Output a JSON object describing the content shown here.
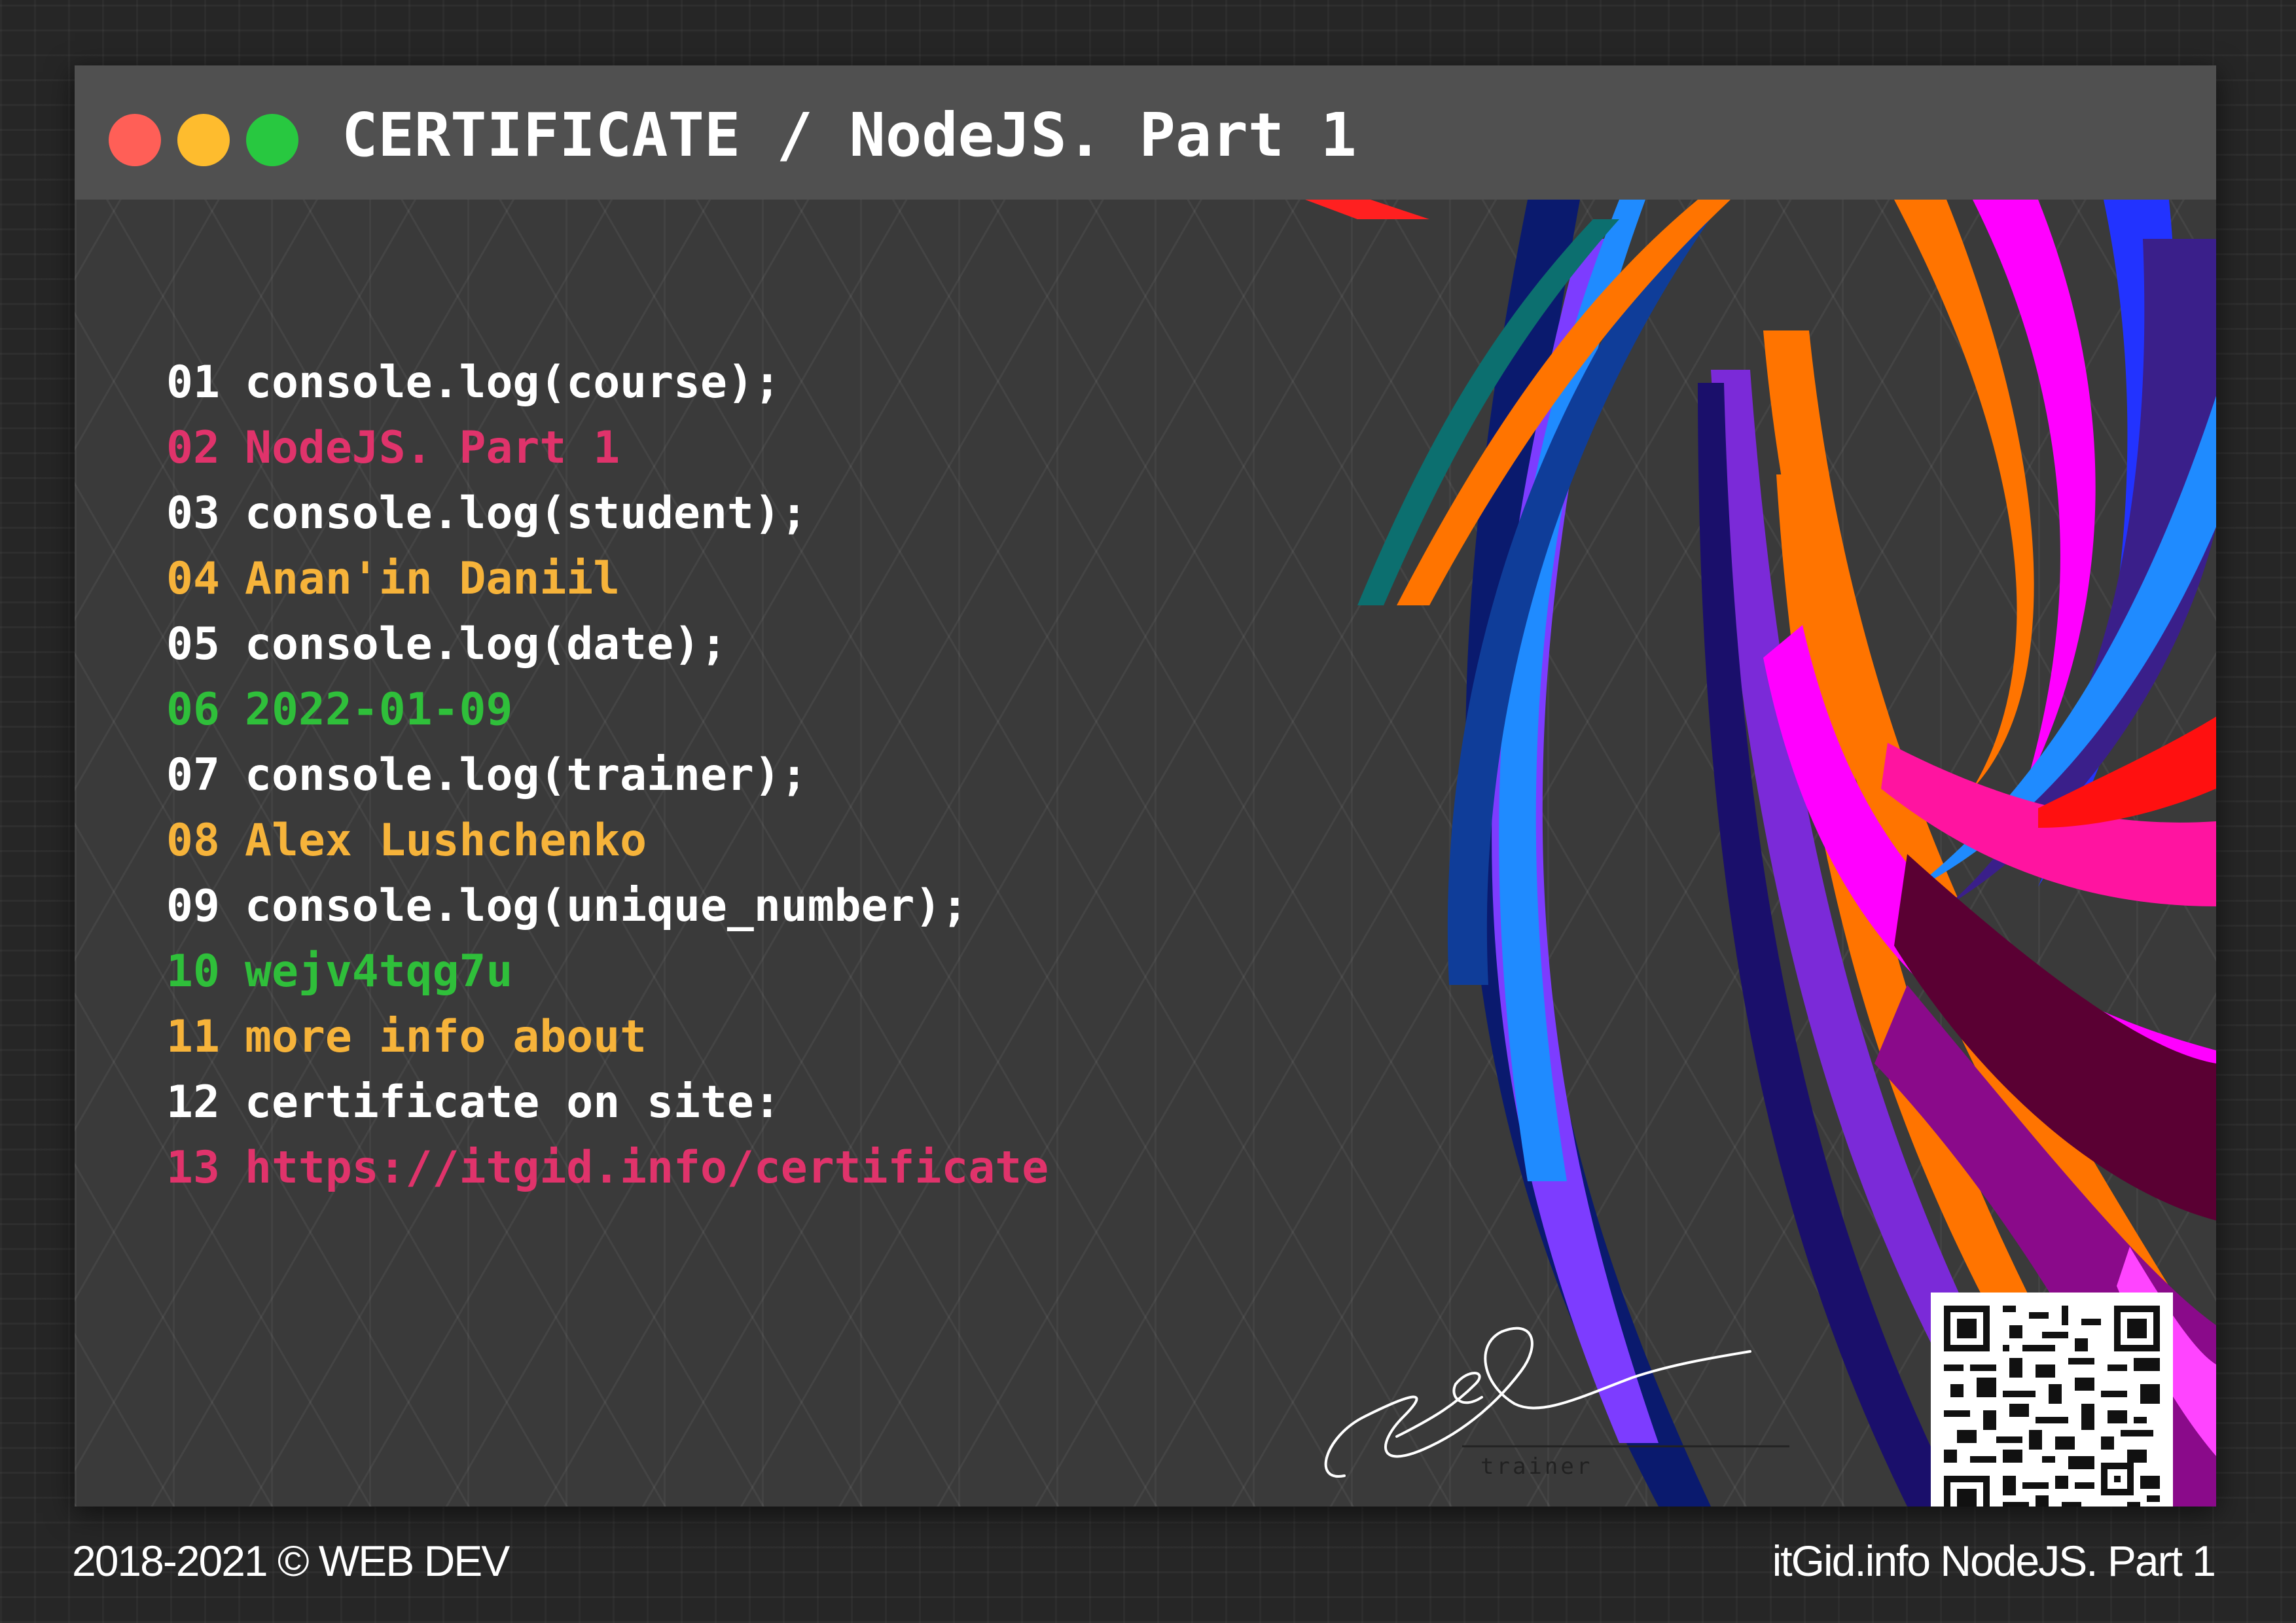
{
  "window": {
    "title": "CERTIFICATE / NodeJS. Part 1",
    "controls": [
      {
        "name": "close",
        "color": "#ff5f57"
      },
      {
        "name": "minimize",
        "color": "#febc2e"
      },
      {
        "name": "maximize",
        "color": "#28c840"
      }
    ]
  },
  "code_lines": [
    {
      "num": "01",
      "text": "console.log(course);",
      "color": "#ffffff"
    },
    {
      "num": "02",
      "text": "NodeJS. Part 1",
      "color": "#e0336b"
    },
    {
      "num": "03",
      "text": "console.log(student);",
      "color": "#ffffff"
    },
    {
      "num": "04",
      "text": "Anan'in Daniil",
      "color": "#f6b33a"
    },
    {
      "num": "05",
      "text": "console.log(date);",
      "color": "#ffffff"
    },
    {
      "num": "06",
      "text": "2022-01-09",
      "color": "#2fbf3a"
    },
    {
      "num": "07",
      "text": "console.log(trainer);",
      "color": "#ffffff"
    },
    {
      "num": "08",
      "text": "Alex Lushchenko",
      "color": "#f6b33a"
    },
    {
      "num": "09",
      "text": "console.log(unique_number);",
      "color": "#ffffff"
    },
    {
      "num": "10",
      "text": "wejv4tqg7u",
      "color": "#2fbf3a"
    },
    {
      "num": "11",
      "text": "more info about",
      "color": "#f6b33a"
    },
    {
      "num": "12",
      "text": "certificate on site:",
      "color": "#ffffff"
    },
    {
      "num": "13",
      "text": "https://itgid.info/certificate",
      "color": "#e0336b"
    }
  ],
  "signature": {
    "label": "trainer"
  },
  "qr_code": {
    "icon": "qr-code-icon"
  },
  "footer": {
    "left": "2018-2021 © WEB DEV",
    "right": "itGid.info NodeJS. Part 1"
  }
}
